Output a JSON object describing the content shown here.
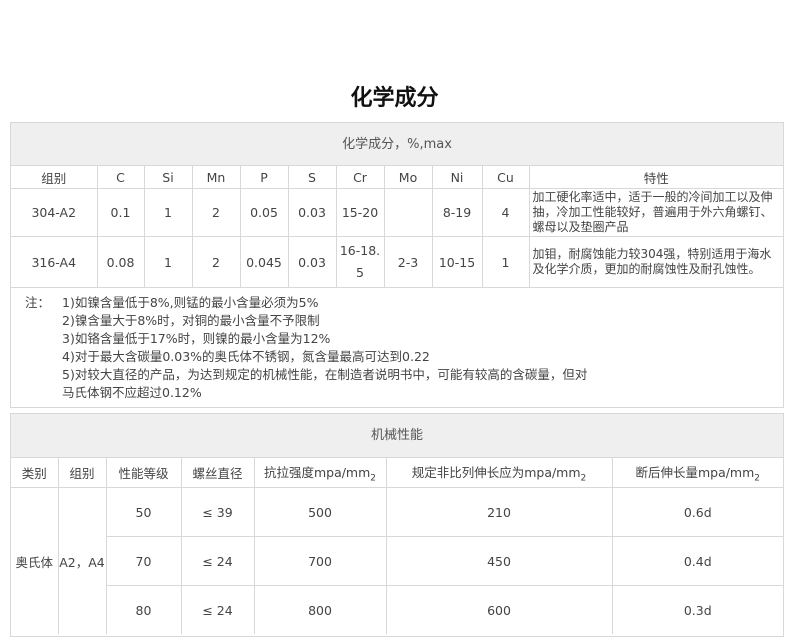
{
  "title": "化学成分",
  "chemical": {
    "caption": "化学成分，%,max",
    "headers": [
      "组别",
      "C",
      "Si",
      "Mn",
      "P",
      "S",
      "Cr",
      "Mo",
      "Ni",
      "Cu",
      "特性"
    ],
    "rows": [
      [
        "304-A2",
        "0.1",
        "1",
        "2",
        "0.05",
        "0.03",
        "15-20",
        "",
        "8-19",
        "4",
        "加工硬化率适中，适于一般的冷间加工以及伸抽，冷加工性能较好，普遍用于外六角螺钉、螺母以及垫圈产品"
      ],
      [
        "316-A4",
        "0.08",
        "1",
        "2",
        "0.045",
        "0.03",
        "16-18.5",
        "2-3",
        "10-15",
        "1",
        "加钼，耐腐蚀能力较304强，特别适用于海水及化学介质，更加的耐腐蚀性及耐孔蚀性。"
      ]
    ],
    "notes_label": "注：",
    "notes": [
      "1)如镍含量低于8%,则锰的最小含量必须为5%",
      "2)镍含量大于8%时，对铜的最小含量不予限制",
      "3)如铬含量低于17%时，则镍的最小含量为12%",
      "4)对于最大含碳量0.03%的奥氏体不锈钢，氮含量最高可达到0.22",
      "5)对较大直径的产品，为达到规定的机械性能，在制造者说明书中，可能有较高的含碳量，但对",
      "马氏体钢不应超过0.12%"
    ]
  },
  "mechanical": {
    "caption": "机械性能",
    "headers": [
      "类别",
      "组别",
      "性能等级",
      "螺丝直径",
      "抗拉强度mpa/mm",
      "规定非比列伸长应为mpa/mm",
      "断后伸长量mpa/mm"
    ],
    "header_sub": "2",
    "category": "奥氏体",
    "group": "A2，A4",
    "rows": [
      [
        "50",
        "≤ 39",
        "500",
        "210",
        "0.6d"
      ],
      [
        "70",
        "≤ 24",
        "700",
        "450",
        "0.4d"
      ],
      [
        "80",
        "≤ 24",
        "800",
        "600",
        "0.3d"
      ]
    ]
  }
}
